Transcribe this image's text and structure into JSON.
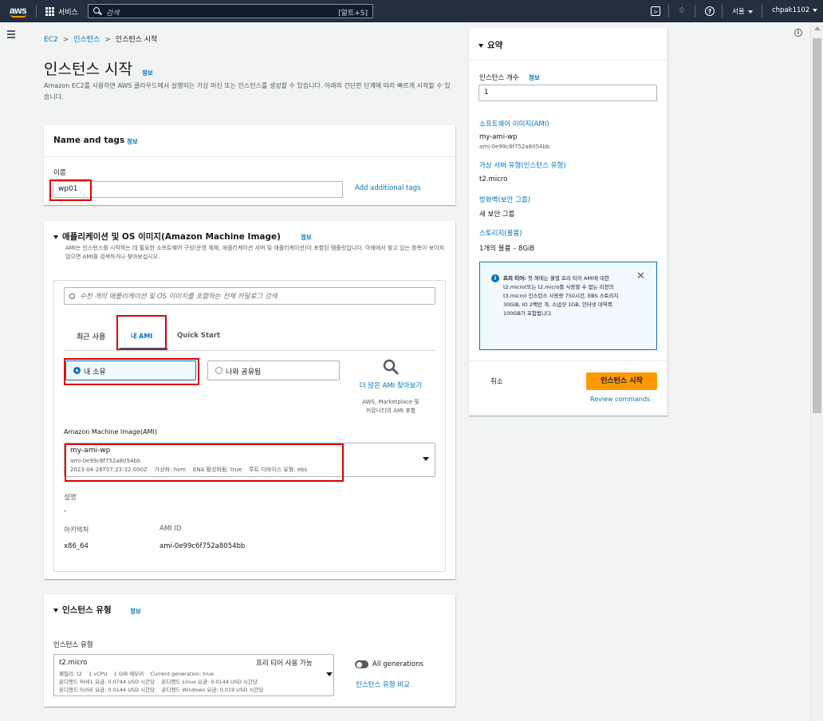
{
  "topbar": {
    "logo": "aws",
    "services": "서비스",
    "search_placeholder": "검색",
    "search_shortcut": "[알트+S]",
    "region": "서울",
    "account": "chpak1102"
  },
  "breadcrumb": {
    "root": "EC2",
    "mid": "인스턴스",
    "current": "인스턴스 시작"
  },
  "page": {
    "title": "인스턴스 시작",
    "info": "정보",
    "description": "Amazon EC2를 사용하면 AWS 클라우드에서 실행되는 가상 머신 또는 인스턴스를 생성할 수 있습니다. 아래의 간단한 단계에 따라 빠르게 시작할 수 있습니다."
  },
  "name_tags": {
    "title": "Name and tags",
    "info": "정보",
    "name_label": "이름",
    "name_value": "wp01",
    "add_tags": "Add additional tags"
  },
  "ami": {
    "title": "애플리케이션 및 OS 이미지(Amazon Machine Image)",
    "info": "정보",
    "description": "AMI는 인스턴스를 시작하는 데 필요한 소프트웨어 구성(운영 체제, 애플리케이션 서버 및 애플리케이션)이 포함된 템플릿입니다. 아래에서 찾고 있는 항목이 보이지 않으면 AMI를 검색하거나 찾아보십시오.",
    "search_placeholder": "수천 개의 애플리케이션 및 OS 이미지를 포함하는 전체 카탈로그 검색",
    "tabs": [
      "최근 사용",
      "내 AMI",
      "Quick Start"
    ],
    "owned_by_me": "내 소유",
    "shared_with_me": "나와 공유됨",
    "browse_more": "더 많은 AMI 찾아보기",
    "browse_sub": "AWS, Marketplace 및 커뮤니티의 AMI 포함",
    "ami_label": "Amazon Machine Image(AMI)",
    "selected_name": "my-ami-wp",
    "selected_id": "ami-0e99c6f752a8054bb",
    "selected_meta": "2023-04-26T07:23:32.000Z    가상화: hvm    ENA 활성화됨: true    루트 디바이스 유형: ebs",
    "desc_label": "설명",
    "desc_value": "-",
    "arch_label": "아키텍처",
    "arch_value": "x86_64",
    "amiid_label": "AMI ID",
    "amiid_value": "ami-0e99c6f752a8054bb"
  },
  "instance_type": {
    "title": "인스턴스 유형",
    "info": "정보",
    "label": "인스턴스 유형",
    "value": "t2.micro",
    "free_tier": "프리 티어 사용 가능",
    "line1": "패밀리: t2    1 vCPU    1 GiB 메모리    Current generation: true",
    "line2": "온디맨드 RHEL 요금: 0.0744 USD 시간당    온디맨드 Linux 요금: 0.0144 USD 시간당",
    "line3": "온디맨드 SUSE 요금: 0.0144 USD 시간당    온디맨드 Windows 요금: 0.019 USD 시간당",
    "all_generations": "All generations",
    "compare": "인스턴스 유형 비교"
  },
  "summary": {
    "title": "요약",
    "count_label": "인스턴스 개수",
    "count_info": "정보",
    "count_value": "1",
    "software_label": "소프트웨어 이미지(AMI)",
    "software_name": "my-ami-wp",
    "software_id": "ami-0e99c6f752a8054bb",
    "server_type_label": "가상 서버 유형(인스턴스 유형)",
    "server_type_value": "t2.micro",
    "firewall_label": "방화벽(보안 그룹)",
    "firewall_value": "새 보안 그룹",
    "storage_label": "스토리지(볼륨)",
    "storage_value": "1개의 볼륨 – 8GiB",
    "free_tier_title": "프리 티어:",
    "free_tier_text": "첫 해에는 월별 프리 티어 AMI에 대한 t2.micro(또는 t2.micro를 사용할 수 없는 리전의 t3.micro) 인스턴스 사용량 750시간, EBS 스토리지 30GiB, IO 2백만 개, 스냅샷 1GB, 인터넷 대역폭 100GB가 포함됩니다.",
    "cancel": "취소",
    "launch": "인스턴스 시작",
    "review": "Review commands"
  }
}
